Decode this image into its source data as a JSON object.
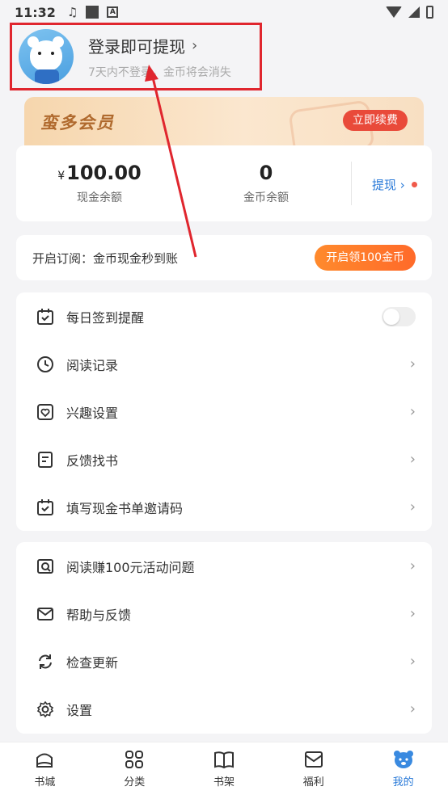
{
  "status_bar": {
    "time": "11:32"
  },
  "profile": {
    "title": "登录即可提现",
    "subtitle": "7天内不登录，金币将会消失"
  },
  "vip": {
    "title": "蛮多会员",
    "renew_label": "立即续费"
  },
  "balance": {
    "cash_currency": "¥",
    "cash_value": "100.00",
    "cash_label": "现金余额",
    "coin_value": "0",
    "coin_label": "金币余额",
    "withdraw_label": "提现"
  },
  "subscribe": {
    "text": "开启订阅：金币现金秒到账",
    "button": "开启领100金币"
  },
  "menu1": [
    {
      "label": "每日签到提醒",
      "icon": "calendar-check-icon"
    },
    {
      "label": "阅读记录",
      "icon": "clock-icon"
    },
    {
      "label": "兴趣设置",
      "icon": "heart-icon"
    },
    {
      "label": "反馈找书",
      "icon": "document-icon"
    },
    {
      "label": "填写现金书单邀请码",
      "icon": "calendar-check-icon"
    }
  ],
  "menu2": [
    {
      "label": "阅读赚100元活动问题",
      "icon": "search-icon"
    },
    {
      "label": "帮助与反馈",
      "icon": "mail-icon"
    },
    {
      "label": "检查更新",
      "icon": "refresh-icon"
    },
    {
      "label": "设置",
      "icon": "gear-icon"
    }
  ],
  "tabs": [
    {
      "label": "书城",
      "icon": "home-icon"
    },
    {
      "label": "分类",
      "icon": "grid-icon"
    },
    {
      "label": "书架",
      "icon": "book-icon"
    },
    {
      "label": "福利",
      "icon": "gift-icon"
    },
    {
      "label": "我的",
      "icon": "bear-icon"
    }
  ],
  "colors": {
    "accent": "#2a7ad8",
    "highlight_box": "#e0262e",
    "orange": "#ff7a2a"
  }
}
